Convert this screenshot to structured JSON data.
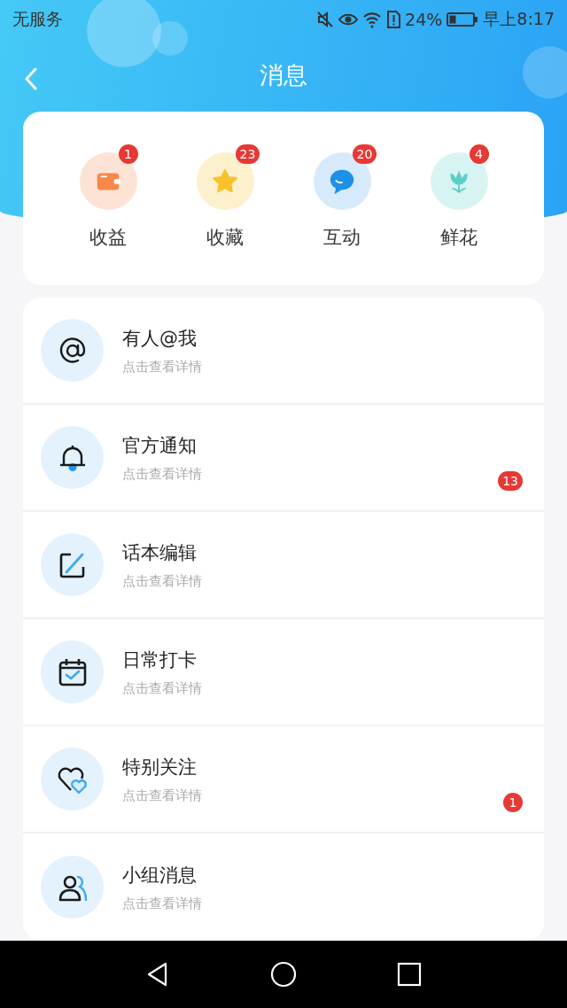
{
  "status_bar": {
    "carrier": "无服务",
    "battery_percent": "24%",
    "time": "早上8:17"
  },
  "header": {
    "title": "消息"
  },
  "categories": [
    {
      "label": "收益",
      "badge": "1"
    },
    {
      "label": "收藏",
      "badge": "23"
    },
    {
      "label": "互动",
      "badge": "20"
    },
    {
      "label": "鲜花",
      "badge": "4"
    }
  ],
  "messages": [
    {
      "title": "有人@我",
      "subtitle": "点击查看详情"
    },
    {
      "title": "官方通知",
      "subtitle": "点击查看详情",
      "badge": "13"
    },
    {
      "title": "话本编辑",
      "subtitle": "点击查看详情"
    },
    {
      "title": "日常打卡",
      "subtitle": "点击查看详情"
    },
    {
      "title": "特别关注",
      "subtitle": "点击查看详情",
      "badge": "1"
    },
    {
      "title": "小组消息",
      "subtitle": "点击查看详情"
    }
  ]
}
